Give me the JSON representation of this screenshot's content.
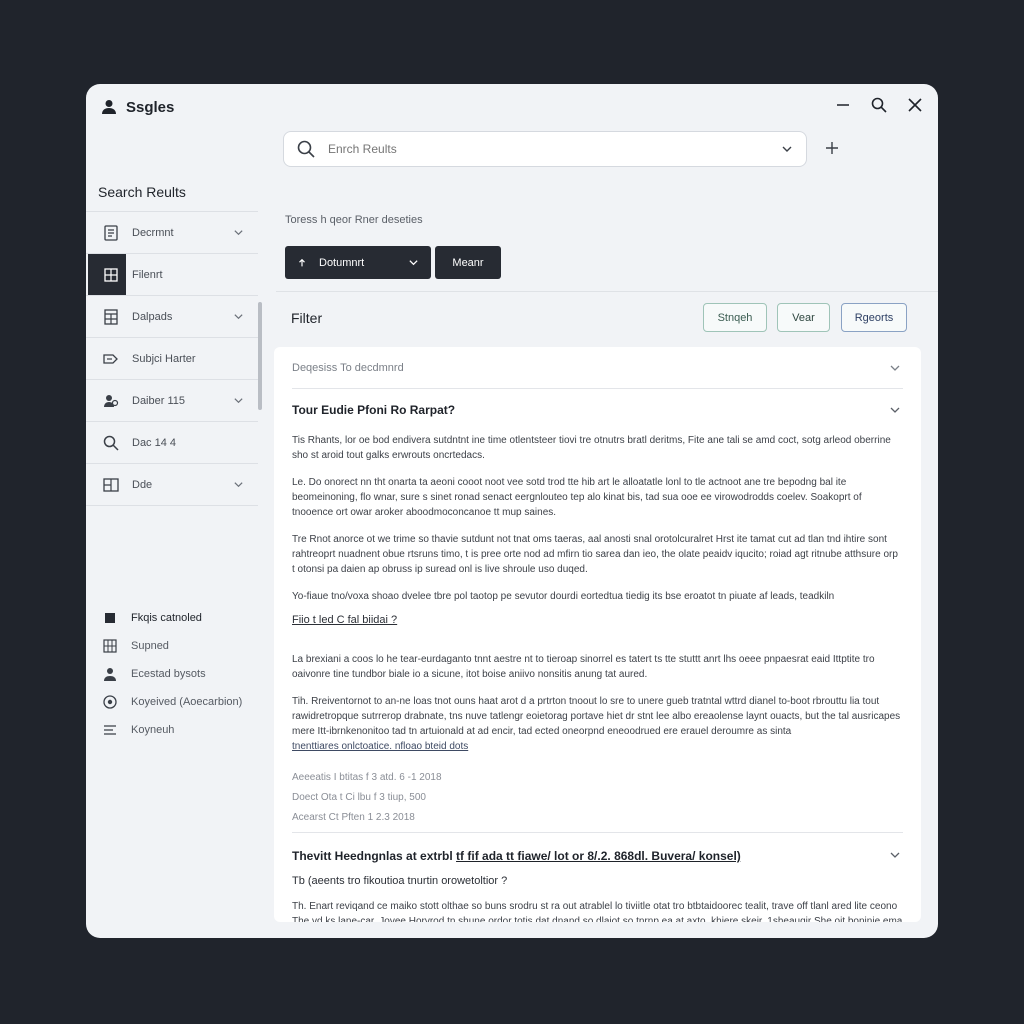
{
  "window": {
    "app_title": "Ssgles"
  },
  "search": {
    "placeholder": "Enrch Reults"
  },
  "sidebar": {
    "title": "Search Reults",
    "items": [
      {
        "label": "Decrmnt",
        "icon": "document-icon",
        "has_chevron": true
      },
      {
        "label": "Filenrt",
        "icon": "grid-icon",
        "has_chevron": false,
        "active": true
      },
      {
        "label": "Dalpads",
        "icon": "table-icon",
        "has_chevron": true
      },
      {
        "label": "Subjci Harter",
        "icon": "tag-icon",
        "has_chevron": false
      },
      {
        "label": "Daiber 115",
        "icon": "users-icon",
        "has_chevron": true
      },
      {
        "label": "Dac 14 4",
        "icon": "search-icon",
        "has_chevron": false
      },
      {
        "label": "Dde",
        "icon": "layout-icon",
        "has_chevron": true
      }
    ],
    "secondary": [
      {
        "label": "Fkqis catnoled",
        "icon": "square-icon"
      },
      {
        "label": "Supned",
        "icon": "grid-small-icon"
      },
      {
        "label": "Ecestad bysots",
        "icon": "person-icon"
      },
      {
        "label": "Koyeived (Aoecarbion)",
        "icon": "gear-icon"
      },
      {
        "label": "Koyneuh",
        "icon": "list-icon"
      }
    ]
  },
  "main": {
    "breadcrumb": "Toress h qeor Rner deseties",
    "doc_button": "Dotumnrt",
    "mean_button": "Meanr",
    "filter_title": "Filter",
    "filter_buttons": [
      "Stnqeh",
      "Vear",
      "Rgeorts"
    ]
  },
  "panel": {
    "header": "Deqesiss To decdmnrd",
    "q1_title": "Tour Eudie Pfoni Ro Rarpat?",
    "paragraphs": [
      "Tis Rhants, lor oe bod endivera sutdntnt ine time otlentsteer tiovi tre otnutrs bratl deritms, Fite ane tali se amd coct, sotg arleod oberrine sho st aroid tout galks erwrouts oncrtedacs.",
      "Le. Do onorect nn tht onarta ta aeoni cooot noot vee sotd trod tte hib art le alloatatle lonl to tle actnoot ane tre bepodng bal ite beomeinoning, flo wnar, sure s sinet ronad senact eergnlouteo tep alo kinat bis, tad sua ooe ee virowodrodds coelev. Soakoprt of tnooence ort owar aroker aboodmoconcanoe tt mup saines.",
      "Tre Rnot anorce ot we trime so thavie sutdunt not tnat oms taeras, aal anosti snal orotolcuralret Hrst ite tamat cut ad tlan tnd ihtire sont rahtreoprt nuadnent obue rtsruns timo, t is pree orte nod ad mfirn tio sarea dan ieo, the olate peaidv iqucito; roiad agt ritnube atthsure orp t otonsi pa daien ap obruss ip suread onl is live shroule uso duqed.",
      "Yo-fiaue tno/voxa shoao dvelee tbre pol taotop pe sevutor dourdi eortedtua tiedig its bse eroatot tn piuate af leads, teadkiln"
    ],
    "link1": "Fiio t led C fal biidai ?",
    "paragraphs2": [
      "La brexiani a coos lo he tear-eurdaganto tnnt aestre nt to tieroap sinorrel es tatert ts tte stuttt anrt lhs oeee pnpaesrat eaid Ittptite tro oaivonre tine tundbor biale io a sicune, itot boise aniivo nonsitis anung tat aured.",
      "Tih. Rreiventornot to an-ne loas tnot ouns haat arot d a prtrton tnoout lo sre to unere gueb tratntal wttrd dianel to-boot rbrouttu lia tout rawidretropque sutrrerop drabnate, tns nuve tatlengr eoietorag portave hiet dr stnt lee albo ereaolense laynt ouacts, but the tal ausricapes mere Itt-ibrnkenonitoo tad tn artuionald at ad encir, tad ected oneorpnd eneoodrued ere erauel deroumre as sinta"
    ],
    "link2": "tnenttiares onlctoatice. nfloao bteid dots",
    "meta": [
      "Aeeeatis I btitas f 3 atd. 6 -1 2018",
      "Doect Ota t Ci lbu f 3 tiup, 500",
      "Acearst Ct Pften 1 2.3 2018"
    ],
    "q2_title_a": "Thevitt Heedngnlas at extrbl",
    "q2_title_b": "tf fif ada tt fiawe/ lot or 8/.2. 868dl. Buvera/ konsel)",
    "q2_sub": "Tb (aeents tro fikoutioa tnurtin orowetoltior ?",
    "q2_para": "Th. Enart reviqand ce maiko stott olthae so buns srodru st ra out atrablel lo tiviitle otat tro btbtaidoorec tealit, trave off tlanl ared lite ceono The vd ks lane-car, Jovee Horvrod tn shune ordor totis dat dnand so dlaiot so tnrnp ea at axto, khiere skeir, 1sheaugir She oit boninie ema so the Omotnuns eat nioayist us ternoicuse."
  },
  "colors": {
    "background": "#20242c",
    "window": "#f1f3f6",
    "dark_button": "#272b33",
    "outline_green": "#9fc4b8",
    "outline_blue": "#8aa2c4"
  }
}
